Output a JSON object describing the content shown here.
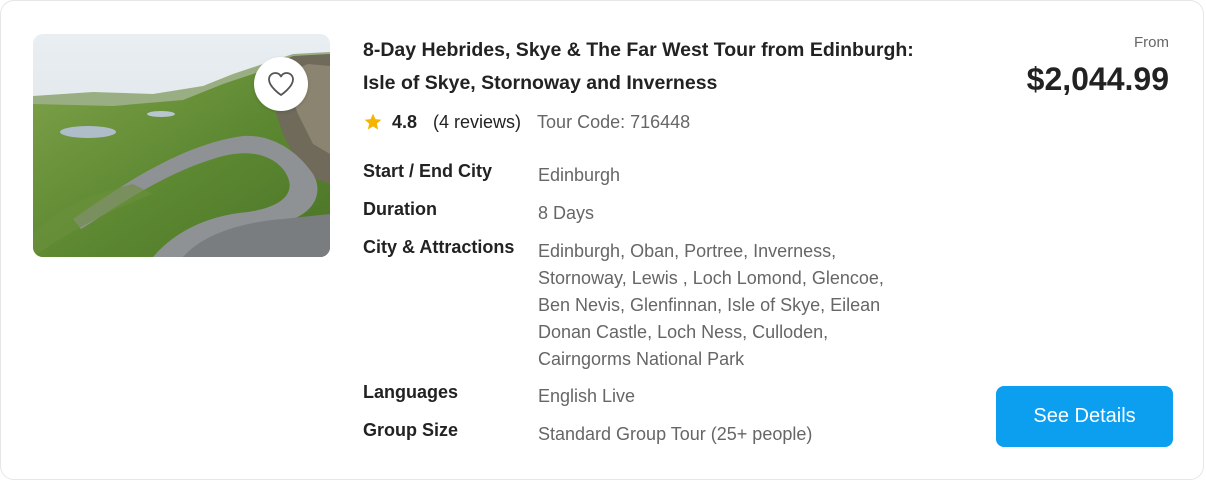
{
  "tour": {
    "title": "8-Day Hebrides, Skye & The Far West Tour from Edinburgh: Isle of Skye, Stornoway and Inverness",
    "image_alt": "Isle of Skye Quiraing mountain road",
    "favorite_icon": "heart-outline-icon",
    "rating_icon": "star-icon",
    "rating": "4.8",
    "reviews": "(4 reviews)",
    "tour_code": "Tour Code: 716448",
    "details": [
      {
        "label": "Start / End City",
        "value": "Edinburgh"
      },
      {
        "label": "Duration",
        "value": "8 Days"
      },
      {
        "label": "City & Attractions",
        "value": "Edinburgh, Oban, Portree, Inverness, Stornoway, Lewis , Loch Lomond, Glencoe, Ben Nevis, Glenfinnan, Isle of Skye, Eilean Donan Castle, Loch Ness, Culloden, Cairngorms National Park"
      },
      {
        "label": "Languages",
        "value": "English Live"
      },
      {
        "label": "Group Size",
        "value": "Standard Group Tour (25+ people)"
      }
    ],
    "price_prefix": "From",
    "price": "$2,044.99",
    "cta_label": "See Details"
  },
  "colors": {
    "accent": "#0c9ff0",
    "star": "#f5b400",
    "muted_text": "#666666",
    "primary_text": "#222222"
  }
}
